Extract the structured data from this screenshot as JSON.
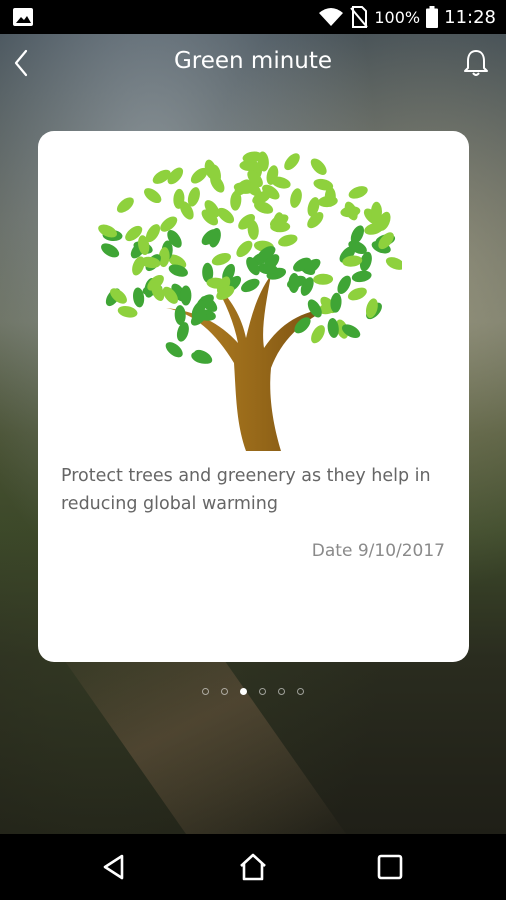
{
  "status_bar": {
    "battery": "100%",
    "time": "11:28"
  },
  "header": {
    "title": "Green minute"
  },
  "card": {
    "message": "Protect trees and greenery as they help in reducing global warming",
    "date": "Date 9/10/2017"
  },
  "pager": {
    "total": 6,
    "active_index": 2
  },
  "colors": {
    "leaf_dark": "#3fa535",
    "leaf_light": "#8ed13d",
    "trunk": "#a87a22",
    "card_bg": "#ffffff"
  }
}
